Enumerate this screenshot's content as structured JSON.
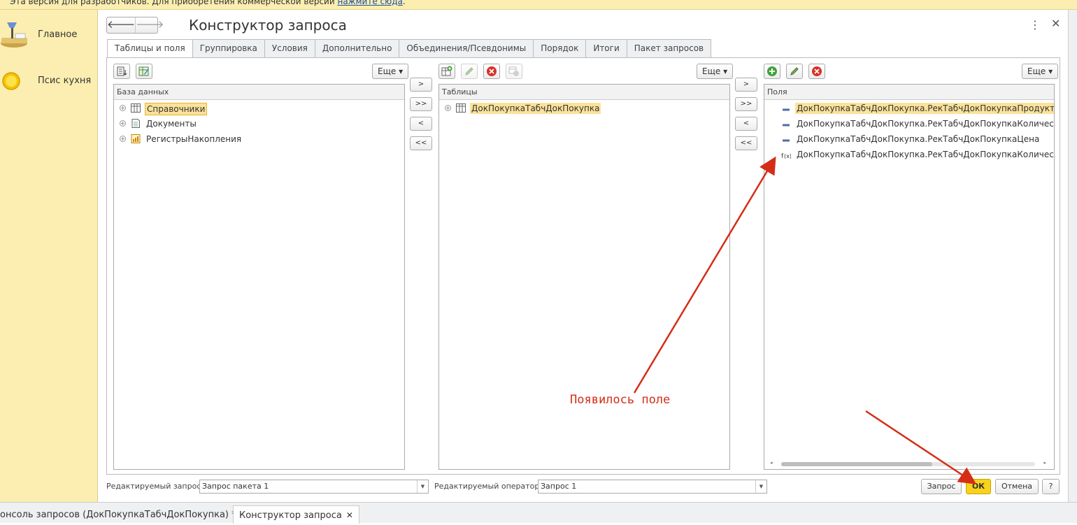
{
  "topbar": {
    "text": "Эта версия для разработчиков. Для приобретения коммерческой версии ",
    "link": "нажмите сюда",
    "tail": "."
  },
  "sidebar": {
    "items": [
      {
        "label": "Главное",
        "icon": "home-desk-icon"
      },
      {
        "label": "Псис кухня",
        "icon": "sun-circle-icon"
      }
    ]
  },
  "window": {
    "title": "Конструктор запроса",
    "back": "🡐",
    "forward": "🡒",
    "menu": "⋮",
    "close": "✕"
  },
  "tabs": [
    "Таблицы и поля",
    "Группировка",
    "Условия",
    "Дополнительно",
    "Объединения/Псевдонимы",
    "Порядок",
    "Итоги",
    "Пакет запросов"
  ],
  "more_label": "Еще ▾",
  "database": {
    "header": "База данных",
    "items": [
      {
        "label": "Справочники",
        "icon": "catalog-table-icon"
      },
      {
        "label": "Документы",
        "icon": "document-icon"
      },
      {
        "label": "РегистрыНакопления",
        "icon": "accumulation-register-icon"
      }
    ]
  },
  "move_buttons": [
    ">",
    ">>",
    "<",
    "<<"
  ],
  "tables": {
    "header": "Таблицы",
    "items": [
      {
        "label": "ДокПокупкаТабчДокПокупка",
        "icon": "table-icon"
      }
    ]
  },
  "fields": {
    "header": "Поля",
    "items": [
      {
        "label": "ДокПокупкаТабчДокПокупка.РекТабчДокПокупкаПродукт",
        "icon": "field-icon"
      },
      {
        "label": "ДокПокупкаТабчДокПокупка.РекТабчДокПокупкаКоличество",
        "icon": "field-icon"
      },
      {
        "label": "ДокПокупкаТабчДокПокупка.РекТабчДокПокупкаЦена",
        "icon": "field-icon"
      },
      {
        "label": "ДокПокупкаТабчДокПокупка.РекТабчДокПокупкаКоличество * ДокПокупкаТабчДокПокупка.РекТабчДокПокупкаЦена",
        "icon": "expression-icon"
      }
    ]
  },
  "bottom": {
    "query_label": "Редактируемый запрос:",
    "query_value": "Запрос пакета 1",
    "operator_label": "Редактируемый оператор:",
    "operator_value": "Запрос 1",
    "query_btn": "Запрос",
    "ok_btn": "ОК",
    "cancel_btn": "Отмена",
    "help_btn": "?"
  },
  "taskbar": [
    {
      "label": "онсоль запросов (ДокПокупкаТабчДокПокупка) *",
      "close": "✕"
    },
    {
      "label": "Конструктор запроса",
      "close": "✕"
    }
  ],
  "annotation": {
    "text": "Появилось поле",
    "color": "#d42e18"
  },
  "colors": {
    "accent": "#f8d21c",
    "sidebar": "#fbeeb0",
    "highlight": "#fbe29a"
  }
}
